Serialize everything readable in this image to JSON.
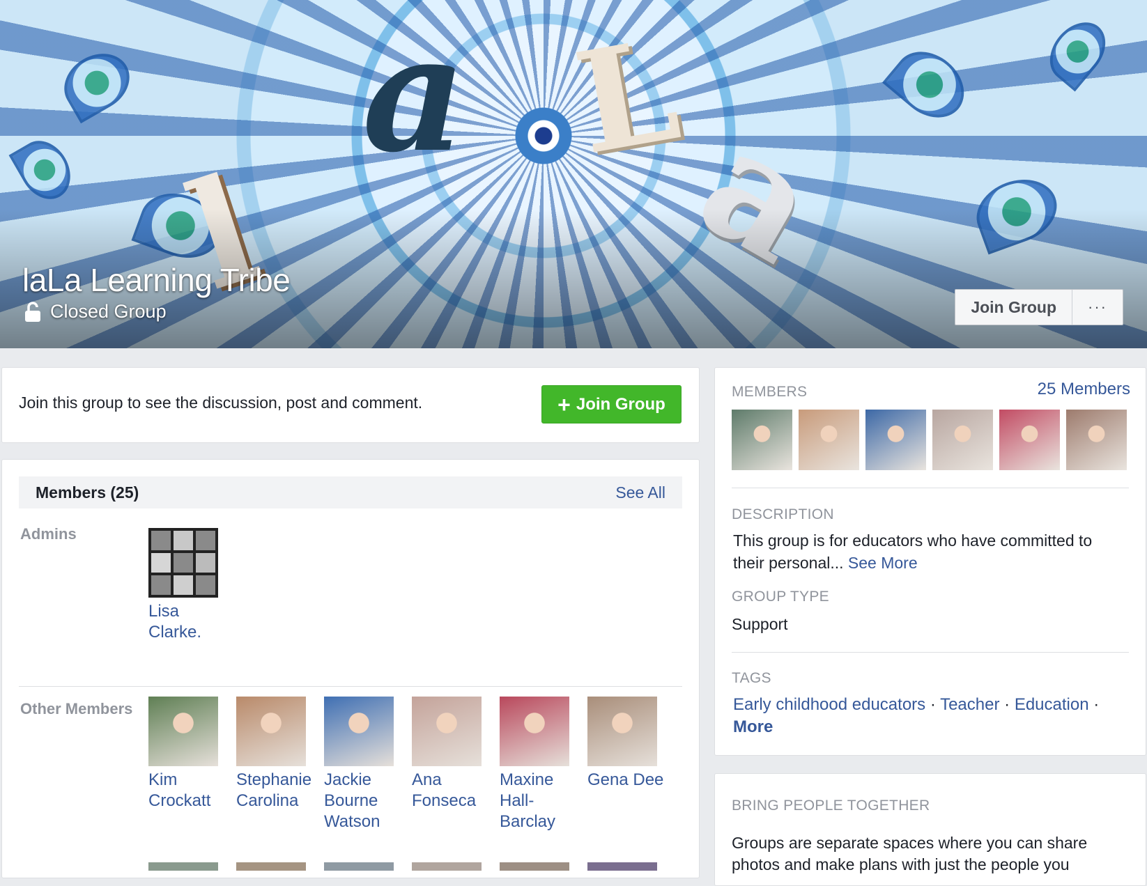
{
  "cover": {
    "group_name": "laLa Learning Tribe",
    "privacy": "Closed Group",
    "join_label": "Join Group",
    "more_label": "···"
  },
  "join_prompt": {
    "text": "Join this group to see the discussion, post and comment.",
    "button_label": "Join Group"
  },
  "members_panel": {
    "title": "Members (25)",
    "see_all": "See All",
    "admins_label": "Admins",
    "admins": [
      {
        "name_line1": "Lisa",
        "name_line2": "Clarke.",
        "tone": "#444444"
      }
    ],
    "other_label": "Other Members",
    "others": [
      {
        "name_line1": "Kim",
        "name_line2": "Crockatt",
        "name_line3": "",
        "tone": "#5f7f54"
      },
      {
        "name_line1": "Stephanie",
        "name_line2": "Carolina",
        "name_line3": "",
        "tone": "#b98a6a"
      },
      {
        "name_line1": "Jackie",
        "name_line2": "Bourne",
        "name_line3": "Watson",
        "tone": "#3f6fb3"
      },
      {
        "name_line1": "Ana",
        "name_line2": "Fonseca",
        "name_line3": "",
        "tone": "#c4a39a"
      },
      {
        "name_line1": "Maxine",
        "name_line2": "Hall-",
        "name_line3": "Barclay",
        "tone": "#b9485c"
      },
      {
        "name_line1": "Gena Dee",
        "name_line2": "",
        "name_line3": "",
        "tone": "#a98e7a"
      }
    ]
  },
  "sidebar": {
    "members_label": "MEMBERS",
    "members_count": "25 Members",
    "strip_tones": [
      "#5e7b6a",
      "#c89b7b",
      "#3c68a6",
      "#b8a6a0",
      "#c24b63",
      "#9d7b6d"
    ],
    "description_label": "DESCRIPTION",
    "description": "This group is for educators who have committed to their personal...",
    "see_more": "See More",
    "group_type_label": "GROUP TYPE",
    "group_type": "Support",
    "tags_label": "TAGS",
    "tags": [
      "Early childhood educators",
      "Teacher",
      "Education"
    ],
    "tags_more": "More",
    "bring_label": "BRING PEOPLE TOGETHER",
    "bring_text": "Groups are separate spaces where you can share photos and make plans with just the people you"
  }
}
